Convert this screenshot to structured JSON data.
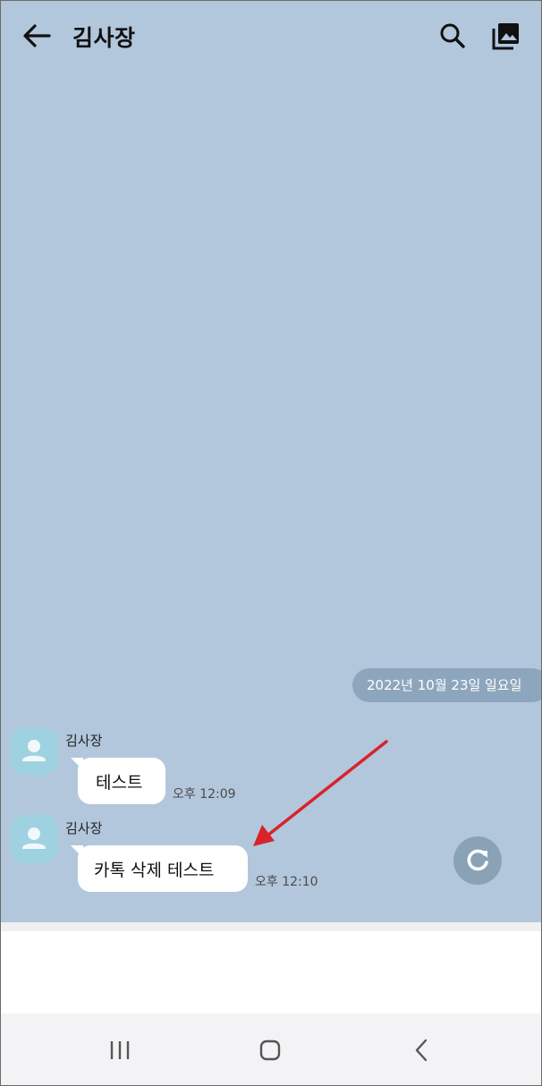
{
  "header": {
    "title": "김사장",
    "back_icon": "arrow-left-icon",
    "search_icon": "search-icon",
    "gallery_icon": "gallery-icon"
  },
  "date_divider": "2022년 10월 23일 일요일",
  "messages": [
    {
      "sender": "김사장",
      "text": "테스트",
      "time": "오후 12:09"
    },
    {
      "sender": "김사장",
      "text": "카톡 삭제 테스트",
      "time": "오후 12:10"
    }
  ],
  "refresh_icon": "refresh-icon",
  "annotation_color": "#d8232a",
  "colors": {
    "chat_background": "#b2c7dc",
    "date_pill": "#8ea6bd",
    "avatar": "#9ed2e0",
    "bubble": "#ffffff"
  },
  "navbar": {
    "recent_icon": "recent-apps-icon",
    "home_icon": "home-icon",
    "back_icon": "nav-back-icon"
  }
}
